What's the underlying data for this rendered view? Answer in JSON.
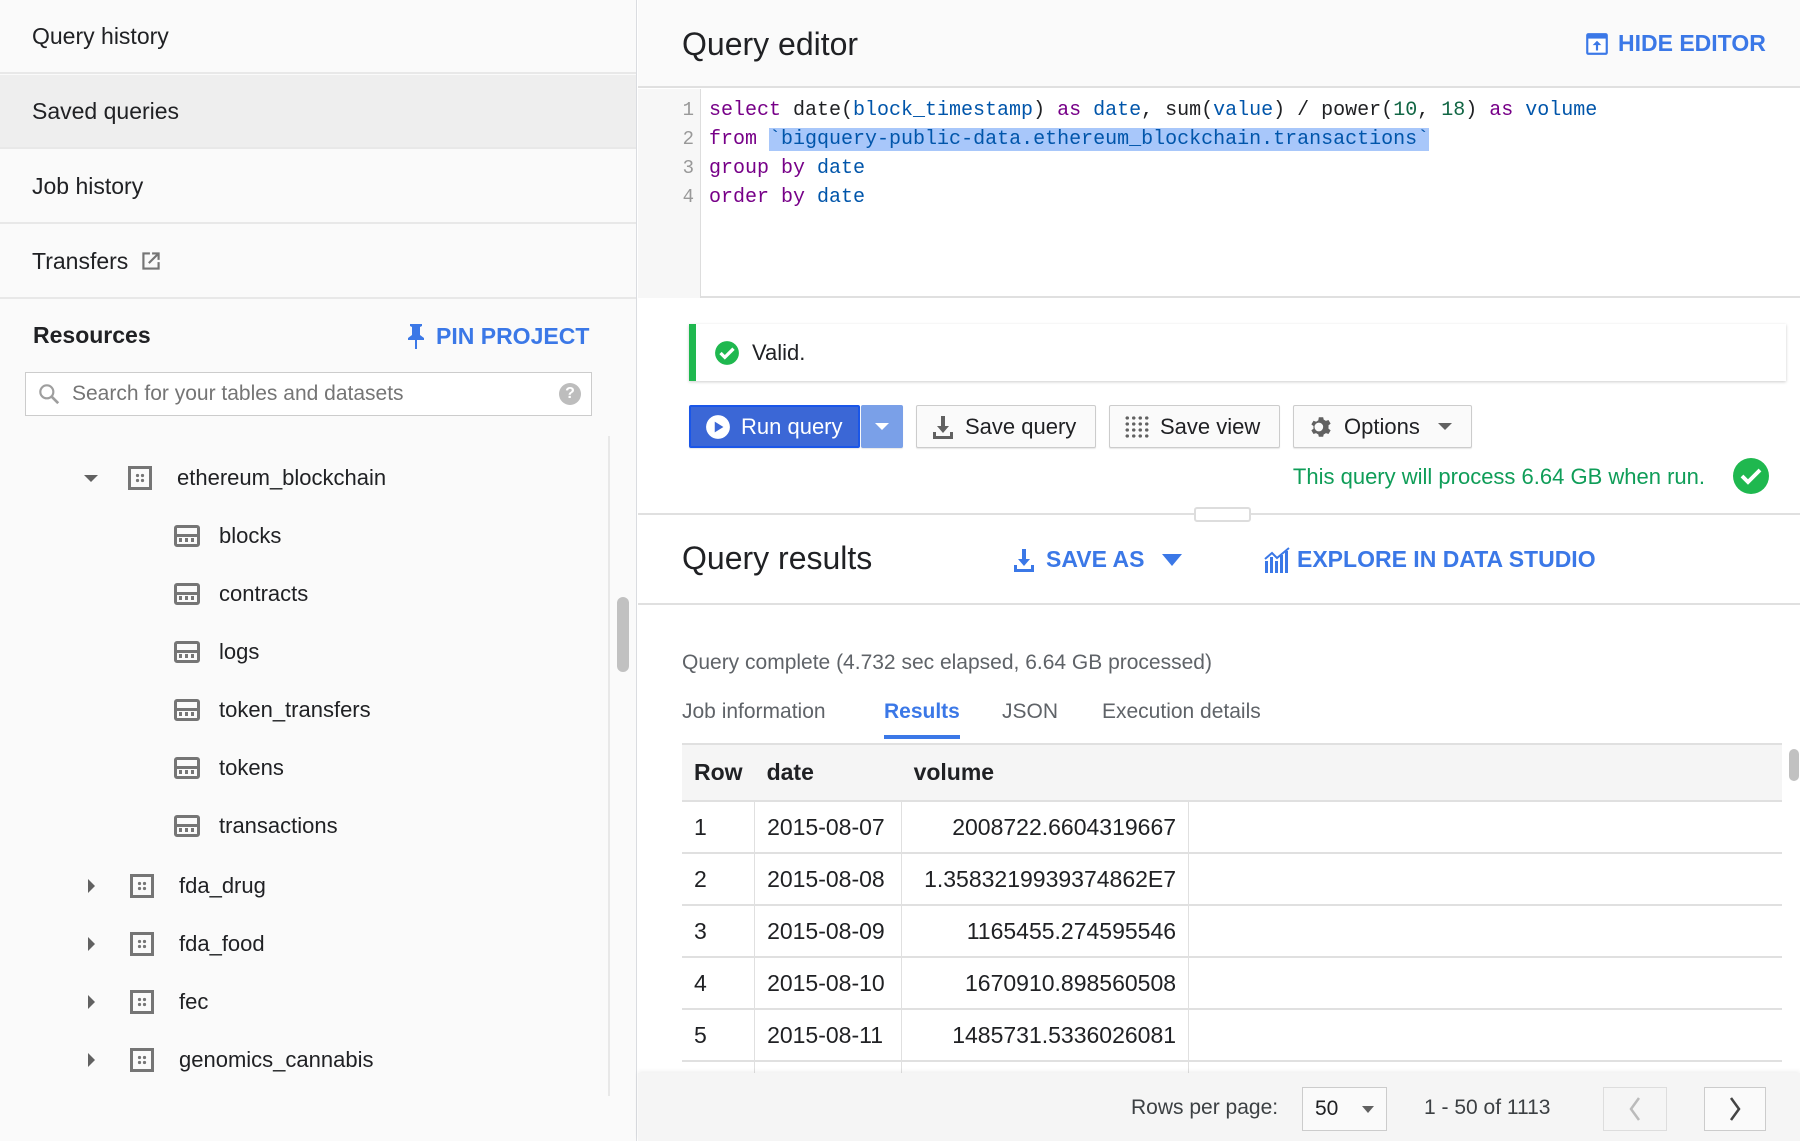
{
  "sidebar": {
    "nav": [
      {
        "label": "Query history"
      },
      {
        "label": "Saved queries"
      },
      {
        "label": "Job history"
      },
      {
        "label": "Transfers"
      }
    ],
    "resources_title": "Resources",
    "pin_project": "PIN PROJECT",
    "search_placeholder": "Search for your tables and datasets",
    "tree": {
      "expanded_dataset": "ethereum_blockchain",
      "tables": [
        "blocks",
        "contracts",
        "logs",
        "token_transfers",
        "tokens",
        "transactions"
      ],
      "datasets": [
        "fda_drug",
        "fda_food",
        "fec",
        "genomics_cannabis"
      ]
    }
  },
  "editor": {
    "title": "Query editor",
    "hide_editor": "HIDE EDITOR",
    "line_numbers": [
      "1",
      "2",
      "3",
      "4"
    ],
    "code": {
      "l1": [
        "select",
        " date(",
        "block_timestamp",
        ") ",
        "as",
        " ",
        "date",
        ", sum(",
        "value",
        ") / power(",
        "10",
        ", ",
        "18",
        ") ",
        "as",
        " ",
        "volume"
      ],
      "l2": [
        "from",
        " ",
        "`bigquery-public-data.ethereum_blockchain.transactions`"
      ],
      "l3": [
        "group by",
        " ",
        "date"
      ],
      "l4": [
        "order by",
        " ",
        "date"
      ]
    },
    "validation": "Valid.",
    "buttons": {
      "run": "Run query",
      "save_query": "Save query",
      "save_view": "Save view",
      "options": "Options"
    },
    "process_info": "This query will process 6.64 GB when run.",
    "success_color": "#0f9d58",
    "accent_color": "#3b78e7"
  },
  "results": {
    "title": "Query results",
    "save_as": "SAVE AS",
    "explore": "EXPLORE IN DATA STUDIO",
    "status": "Query complete (4.732 sec elapsed, 6.64 GB processed)",
    "tabs": [
      {
        "label": "Job information"
      },
      {
        "label": "Results",
        "active": true
      },
      {
        "label": "JSON"
      },
      {
        "label": "Execution details"
      }
    ],
    "columns": [
      "Row",
      "date",
      "volume"
    ],
    "rows": [
      [
        "1",
        "2015-08-07",
        "2008722.6604319667"
      ],
      [
        "2",
        "2015-08-08",
        "1.3583219939374862E7"
      ],
      [
        "3",
        "2015-08-09",
        "1165455.274595546"
      ],
      [
        "4",
        "2015-08-10",
        "1670910.898560508"
      ],
      [
        "5",
        "2015-08-11",
        "1485731.5336026081"
      ]
    ],
    "footer": {
      "rows_per_page_label": "Rows per page:",
      "rows_per_page": "50",
      "range": "1 - 50 of 1113"
    }
  }
}
